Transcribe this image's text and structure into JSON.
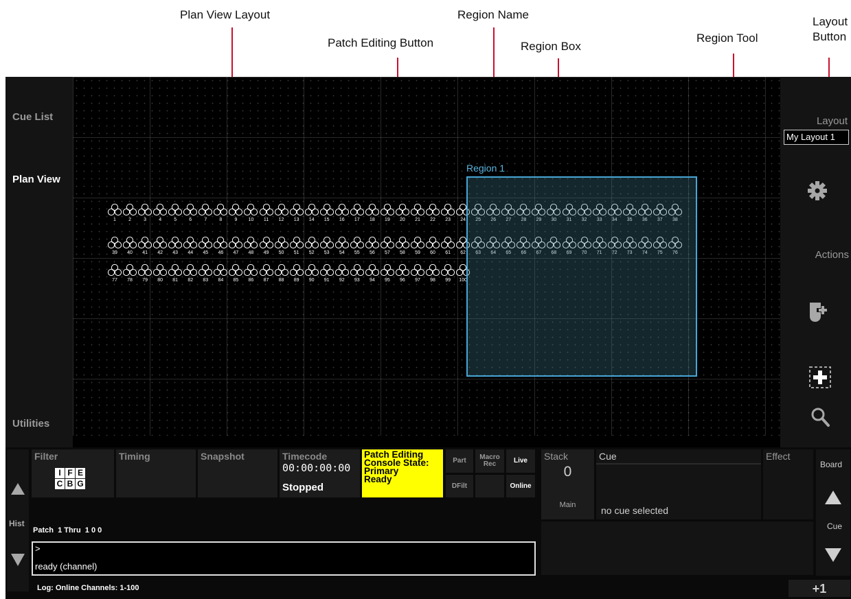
{
  "annotations": {
    "plan_view_layout": "Plan View Layout",
    "region_name": "Region Name",
    "patch_editing_button": "Patch Editing Button",
    "region_box": "Region Box",
    "region_tool": "Region Tool",
    "layout_button_line1": "Layout",
    "layout_button_line2": "Button",
    "arrow_color": "#c8102e"
  },
  "left_nav": {
    "cue_list": "Cue List",
    "plan_view": "Plan View",
    "utilities": "Utilities"
  },
  "plan": {
    "region_label": "Region 1",
    "rows": [
      {
        "start": 1,
        "end": 38
      },
      {
        "start": 39,
        "end": 76
      },
      {
        "start": 77,
        "end": 100
      }
    ],
    "colors": {
      "region_border": "#47a6d6",
      "region_label": "#5bb4e0"
    }
  },
  "right_bar": {
    "layout_label": "Layout",
    "layout_value": "My Layout 1",
    "actions_label": "Actions",
    "icons": [
      "gear-icon",
      "add-channel-icon",
      "region-tool-icon",
      "magnifier-icon"
    ]
  },
  "bottom": {
    "filter": "Filter",
    "filter_logo_top": [
      "I",
      "F",
      "E"
    ],
    "filter_logo_bottom": [
      "C",
      "B",
      "G"
    ],
    "timing": "Timing",
    "snapshot": "Snapshot",
    "timecode_label": "Timecode",
    "timecode_value": "00:00:00:00",
    "timecode_state": "Stopped",
    "patch_line1": "Patch Editing",
    "patch_line2": "Console State:",
    "patch_line3": "Primary",
    "patch_line4": "Ready",
    "patch_color": "#ffff00",
    "part": "Part",
    "macro_rec_1": "Macro",
    "macro_rec_2": "Rec",
    "live": "Live",
    "dfilt": "DFilt",
    "online": "Online",
    "hist": "Hist",
    "command_line": "Patch  1 Thru  1 0 0",
    "prompt": ">",
    "status": "ready (channel)",
    "log": "Log: Online Channels: 1-100",
    "stack_label": "Stack",
    "stack_value": "0",
    "stack_sub": "Main",
    "cue_label": "Cue",
    "cue_empty": "no cue selected",
    "effect_label": "Effect",
    "board": "Board",
    "cue_side": "Cue",
    "plus_one": "+1"
  }
}
